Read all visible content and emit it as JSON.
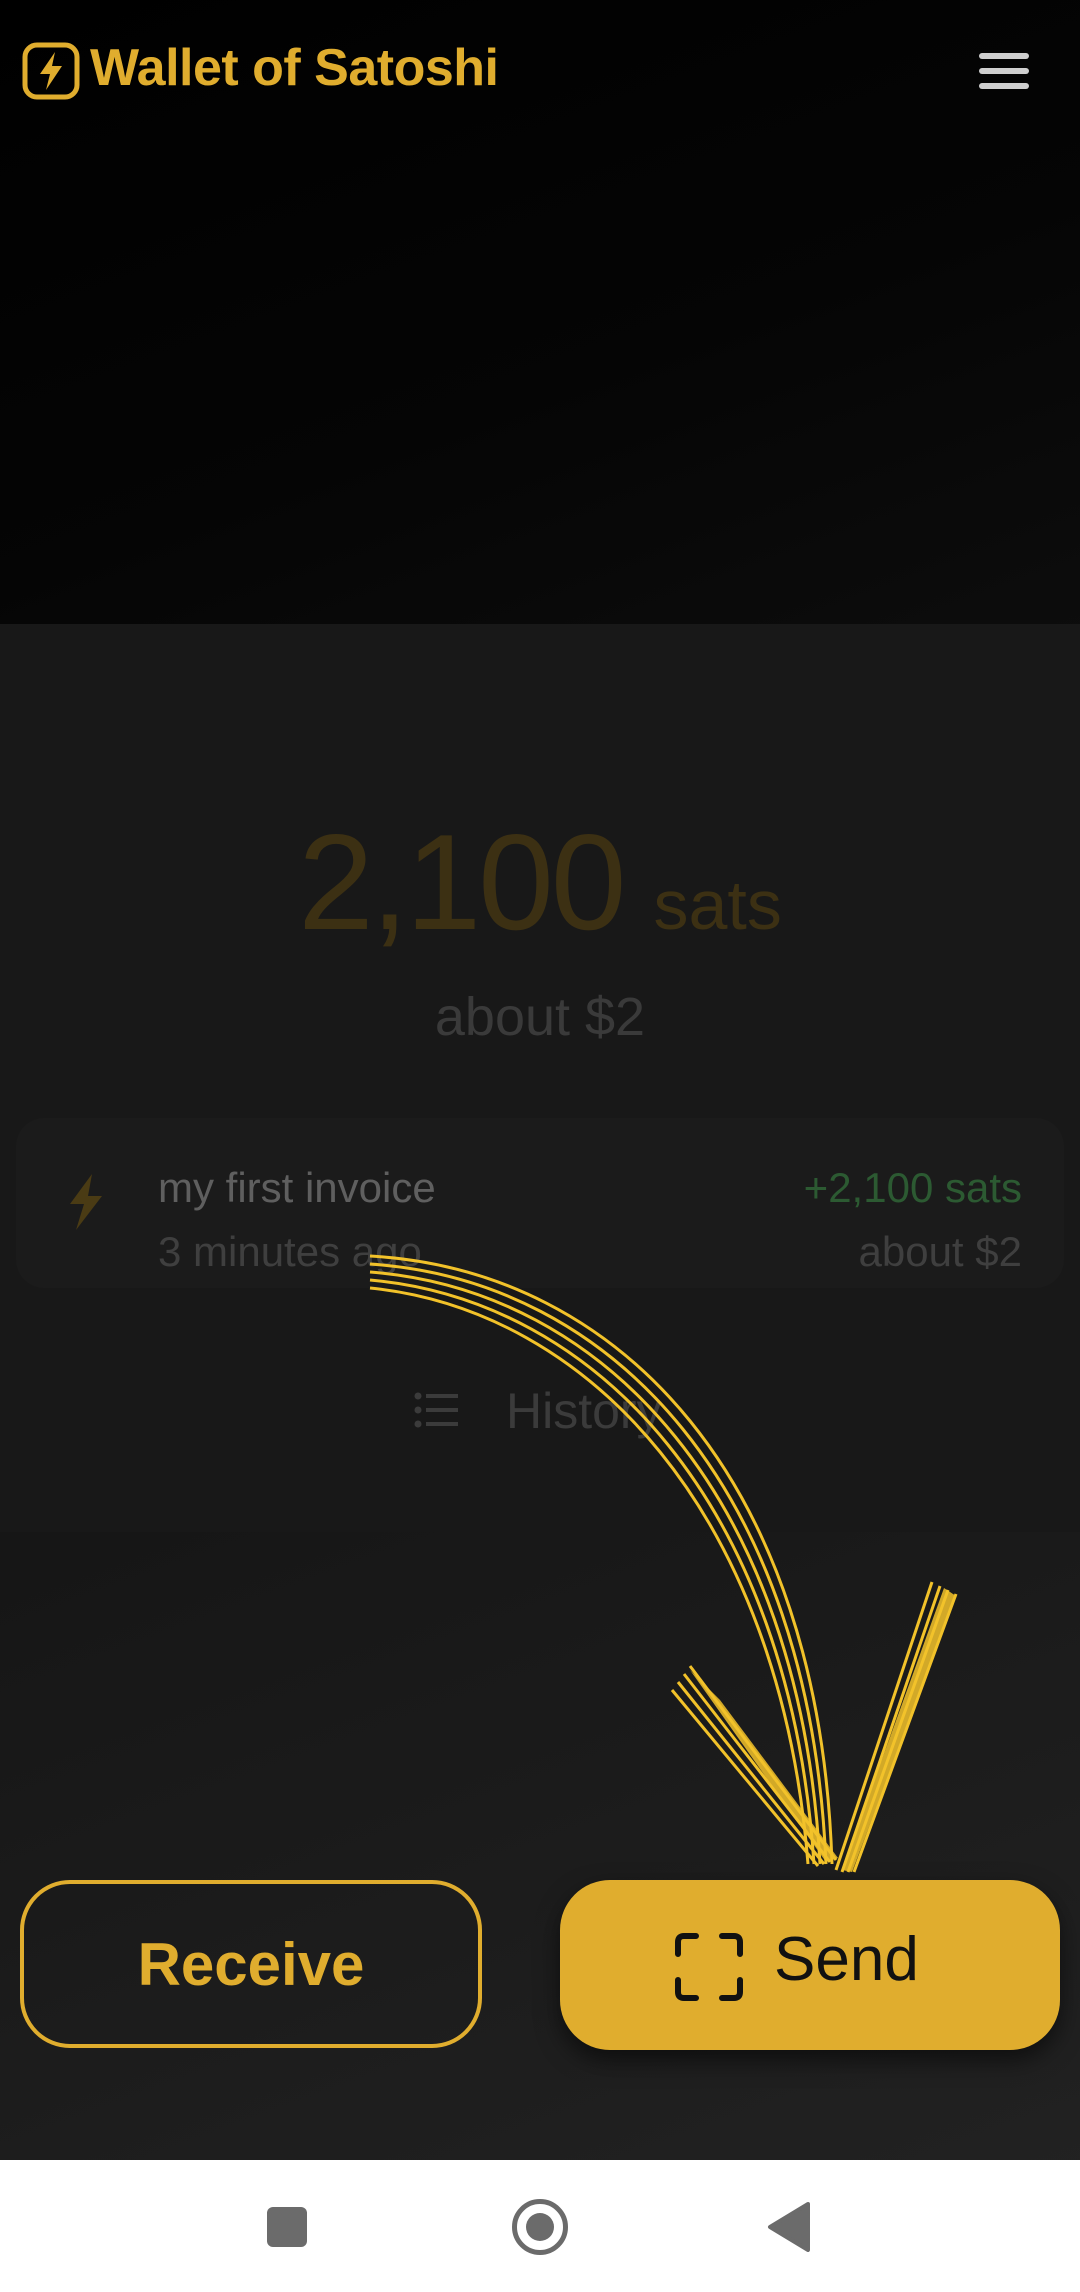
{
  "header": {
    "app_title": "Wallet of Satoshi",
    "logo_icon": "lightning-bolt-icon",
    "menu_icon": "hamburger-menu-icon"
  },
  "balance": {
    "amount": "2,100",
    "unit": "sats",
    "fiat": "about $2"
  },
  "transactions": [
    {
      "icon": "lightning-bolt-icon",
      "title": "my first invoice",
      "time": "3 minutes ago",
      "amount": "+2,100 sats",
      "fiat": "about $2"
    }
  ],
  "history": {
    "label": "History",
    "icon": "list-icon"
  },
  "actions": {
    "receive_label": "Receive",
    "send_label": "Send",
    "send_icon": "scan-icon"
  },
  "nav_bar": {
    "recents_icon": "square-icon",
    "home_icon": "circle-home-icon",
    "back_icon": "triangle-back-icon"
  },
  "colors": {
    "brand": "#e0ad2e",
    "positive": "#2c5a32",
    "background": "#000000"
  }
}
